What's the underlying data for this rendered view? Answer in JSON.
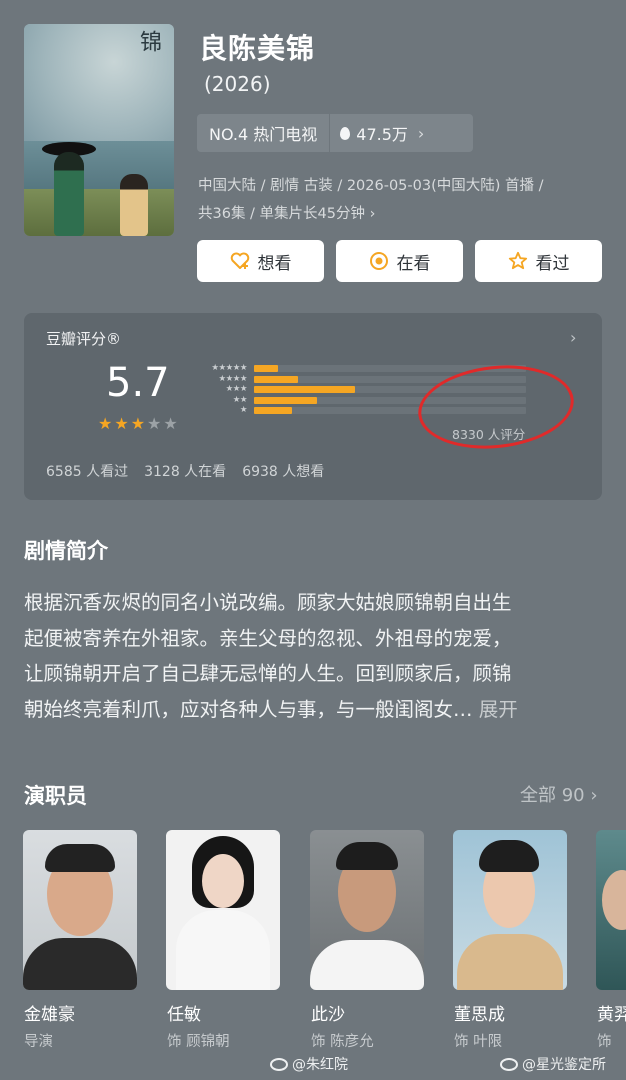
{
  "show": {
    "title": "良陈美锦",
    "year": "(2026)",
    "rank": "NO.4 热门电视",
    "hot": "47.5万",
    "meta_line1": "中国大陆 / 剧情 古装 / 2026-05-03(中国大陆) 首播 /",
    "meta_line2": "共36集 / 单集片长45分钟",
    "poster_calligraphy": "锦"
  },
  "actions": {
    "want": "想看",
    "watching": "在看",
    "watched": "看过"
  },
  "rating": {
    "label": "豆瓣评分®",
    "score": "5.7",
    "stars_filled": 3,
    "stars_total": 5,
    "distribution": [
      {
        "stars": "★★★★★",
        "fraction": 0.09
      },
      {
        "stars": "★★★★",
        "fraction": 0.16
      },
      {
        "stars": "★★★",
        "fraction": 0.37
      },
      {
        "stars": "★★",
        "fraction": 0.23
      },
      {
        "stars": "★",
        "fraction": 0.14
      }
    ],
    "votes": "8330 人评分",
    "watched_count": "6585 人看过",
    "watching_count": "3128 人在看",
    "want_count": "6938 人想看",
    "star_color": "#f5a623",
    "highlight_color": "#e02a2a"
  },
  "synopsis": {
    "title": "剧情简介",
    "lines": [
      "根据沉香灰烬的同名小说改编。顾家大姑娘顾锦朝自出生",
      "起便被寄养在外祖家。亲生父母的忽视、外祖母的宠爱，",
      "让顾锦朝开启了自己肆无忌惮的人生。回到顾家后，顾锦",
      "朝始终亮着利爪，应对各种人与事，与一般闺阁女…"
    ],
    "expand": "展开"
  },
  "cast": {
    "title": "演职员",
    "all": "全部 90",
    "members": [
      {
        "name": "金雄豪",
        "role": "导演"
      },
      {
        "name": "任敏",
        "role": "饰 顾锦朝"
      },
      {
        "name": "此沙",
        "role": "饰 陈彦允"
      },
      {
        "name": "董思成",
        "role": "饰 叶限"
      },
      {
        "name": "黄羿",
        "role": "饰"
      }
    ]
  },
  "watermarks": {
    "left": "@朱红院",
    "right": "@星光鉴定所"
  },
  "colors": {
    "background": "#6e767c",
    "card": "#5f676d",
    "accent": "#f5a623"
  }
}
